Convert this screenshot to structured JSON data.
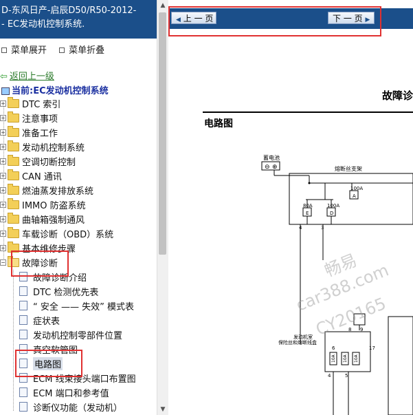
{
  "left_header": {
    "line1": "D-东风日产-启辰D50/R50-2012-",
    "line2": "- EC发动机控制系统."
  },
  "menu_controls": {
    "expand_label": "菜单展开",
    "collapse_label": "菜单折叠"
  },
  "back_link": "返回上一级",
  "current_label": "当前:EC发动机控制系统",
  "tree": {
    "folders": [
      "DTC 索引",
      "注意事项",
      "准备工作",
      "发动机控制系统",
      "空调切断控制",
      "CAN 通讯",
      "燃油蒸发排放系统",
      "IMMO 防盗系统",
      "曲轴箱强制通风",
      "车载诊断（OBD）系统",
      "基本维修步骤",
      "故障诊断"
    ],
    "children": [
      "故障诊断介绍",
      "DTC 检测优先表",
      "“ 安全 —— 失效” 模式表",
      "症状表",
      "发动机控制零部件位置",
      "真空软管图",
      "电路图",
      "ECM 线束接头端口布置图",
      "ECM 端口和参考值",
      "诊断仪功能（发动机）"
    ]
  },
  "toolbar": {
    "prev_label": "上 一 页",
    "next_label": "下 一 页"
  },
  "document": {
    "title": "故障诊",
    "section_title": "电路图"
  },
  "diagram": {
    "battery_label": "蓄电池",
    "fuse_box_label": "熔断丝支架",
    "fuse_100a_top": "100A",
    "fuse_a": "A",
    "fuse_80a": "80A",
    "fuse_e": "E",
    "fuse_100a_left": "100A",
    "fuse_d": "D",
    "ecm_box_label1": "发动机室",
    "ecm_box_label2": "保险丝和熔断线盒",
    "pins": [
      "4",
      "3",
      "8",
      "9",
      "6",
      "17",
      "4",
      "5"
    ],
    "relay_labels": [
      "10A",
      "10A",
      "10A"
    ]
  },
  "watermark": {
    "line1": "畅易",
    "line2": "car388.com",
    "line3": "CY20165"
  }
}
